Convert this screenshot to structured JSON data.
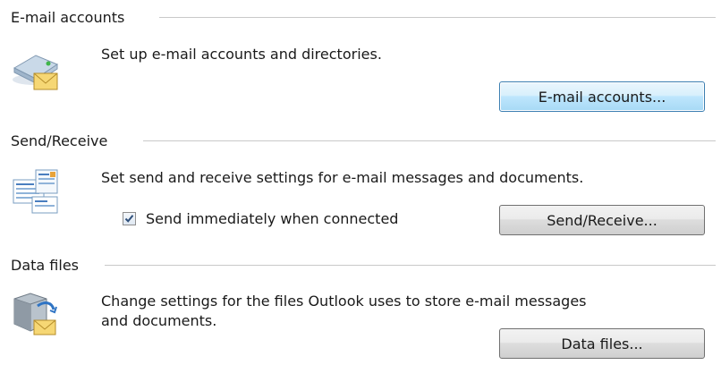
{
  "sections": {
    "email": {
      "title": "E-mail accounts",
      "icon": "email-accounts-icon",
      "description": "Set up e-mail accounts and directories.",
      "button_label": "E-mail accounts..."
    },
    "sendreceive": {
      "title": "Send/Receive",
      "icon": "send-receive-icon",
      "description": "Set send and receive settings for e-mail messages and documents.",
      "checkbox_label": "Send immediately when connected",
      "checkbox_checked": true,
      "button_label": "Send/Receive..."
    },
    "datafiles": {
      "title": "Data files",
      "icon": "data-files-icon",
      "description_line1": "Change settings for the files Outlook uses to store e-mail messages",
      "description_line2": "and documents.",
      "button_label": "Data files..."
    }
  },
  "colors": {
    "focused_button_border": "#3c7fb1",
    "separator": "#c9c9c9"
  }
}
